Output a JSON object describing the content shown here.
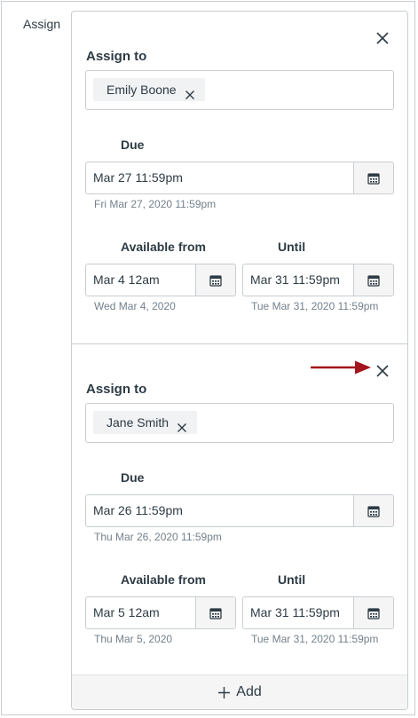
{
  "section_label": "Assign",
  "cards": [
    {
      "assign_to_label": "Assign to",
      "assignee": "Emily Boone",
      "due_label": "Due",
      "due_value": "Mar 27 11:59pm",
      "due_helper": "Fri Mar 27, 2020 11:59pm",
      "available_from_label": "Available from",
      "available_from_value": "Mar 4 12am",
      "available_from_helper": "Wed Mar 4, 2020",
      "until_label": "Until",
      "until_value": "Mar 31 11:59pm",
      "until_helper": "Tue Mar 31, 2020 11:59pm"
    },
    {
      "assign_to_label": "Assign to",
      "assignee": "Jane Smith",
      "due_label": "Due",
      "due_value": "Mar 26 11:59pm",
      "due_helper": "Thu Mar 26, 2020 11:59pm",
      "available_from_label": "Available from",
      "available_from_value": "Mar 5 12am",
      "available_from_helper": "Thu Mar 5, 2020",
      "until_label": "Until",
      "until_value": "Mar 31 11:59pm",
      "until_helper": "Tue Mar 31, 2020 11:59pm"
    }
  ],
  "add_label": "Add",
  "icons": {
    "close": "close-icon",
    "calendar": "calendar-icon",
    "plus": "plus-icon",
    "annotation_arrow": "arrow-right-icon"
  },
  "colors": {
    "annotation_arrow": "#a3141c",
    "text": "#2d3b45",
    "helper_text": "#73818c",
    "border": "#c7cdd1"
  }
}
